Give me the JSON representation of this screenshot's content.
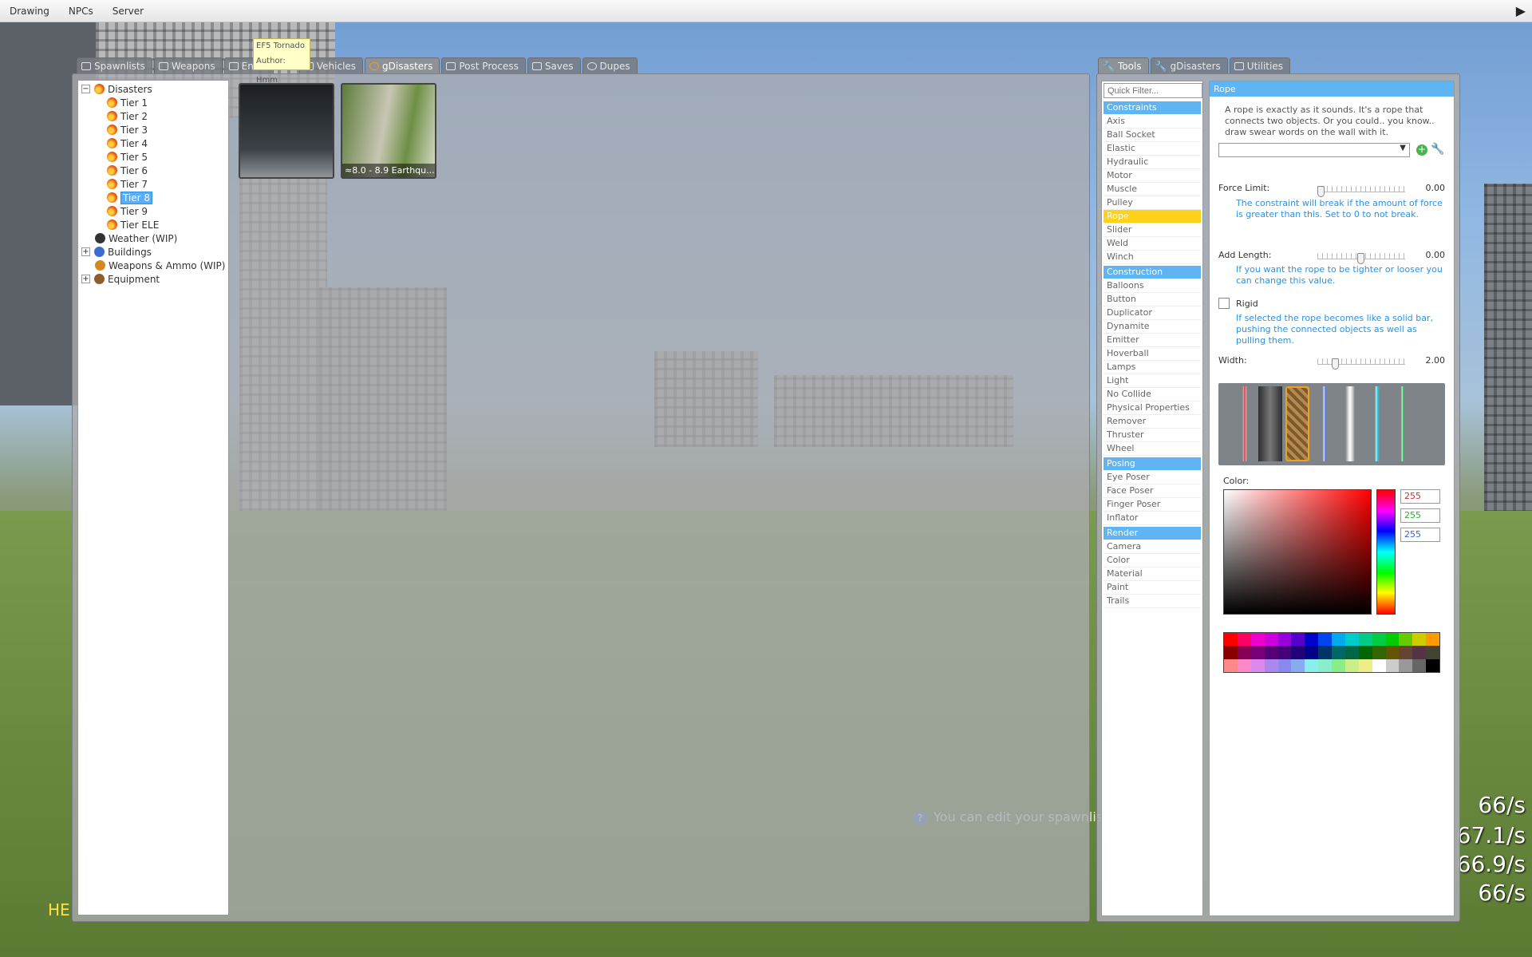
{
  "menubar": {
    "items": [
      "Drawing",
      "NPCs",
      "Server"
    ],
    "expand_icon": "arrow-right-icon"
  },
  "spawn_tabs": [
    {
      "label": "Spawnlists",
      "icon": "spawnlist-icon",
      "active": false
    },
    {
      "label": "Weapons",
      "icon": "weapon-icon",
      "active": false
    },
    {
      "label": "Entiti",
      "icon": "entity-icon",
      "active": false
    },
    {
      "label": "Vehicles",
      "icon": "vehicle-icon",
      "active": false
    },
    {
      "label": "gDisasters",
      "icon": "gdisasters-icon",
      "active": true
    },
    {
      "label": "Post Process",
      "icon": "postprocess-icon",
      "active": false
    },
    {
      "label": "Saves",
      "icon": "saves-icon",
      "active": false
    },
    {
      "label": "Dupes",
      "icon": "dupes-icon",
      "active": false
    }
  ],
  "tooltip": {
    "name": "EF5 Tornado",
    "author": "Author: Hmm"
  },
  "tree": {
    "root": "Disasters",
    "tiers": [
      "Tier 1",
      "Tier 2",
      "Tier 3",
      "Tier 4",
      "Tier 5",
      "Tier 6",
      "Tier 7",
      "Tier 8",
      "Tier 9",
      "Tier ELE"
    ],
    "selected": "Tier 8",
    "others": [
      "Weather (WIP)",
      "Buildings",
      "Weapons & Ammo (WIP)",
      "Equipment"
    ]
  },
  "thumbnails": [
    {
      "caption": ""
    },
    {
      "caption": "≈8.0 - 8.9 Earthqu..."
    }
  ],
  "tool_tabs": [
    {
      "label": "Tools",
      "icon": "wrench-icon",
      "active": true
    },
    {
      "label": "gDisasters",
      "icon": "wrench-icon",
      "active": false
    },
    {
      "label": "Utilities",
      "icon": "utilities-icon",
      "active": false
    }
  ],
  "tool_list": {
    "filter_placeholder": "Quick Filter...",
    "categories": [
      {
        "name": "Constraints",
        "items": [
          "Axis",
          "Ball Socket",
          "Elastic",
          "Hydraulic",
          "Motor",
          "Muscle",
          "Pulley",
          "Rope",
          "Slider",
          "Weld",
          "Winch"
        ]
      },
      {
        "name": "Construction",
        "items": [
          "Balloons",
          "Button",
          "Duplicator",
          "Dynamite",
          "Emitter",
          "Hoverball",
          "Lamps",
          "Light",
          "No Collide",
          "Physical Properties",
          "Remover",
          "Thruster",
          "Wheel"
        ]
      },
      {
        "name": "Posing",
        "items": [
          "Eye Poser",
          "Face Poser",
          "Finger Poser",
          "Inflator"
        ]
      },
      {
        "name": "Render",
        "items": [
          "Camera",
          "Color",
          "Material",
          "Paint",
          "Trails"
        ]
      }
    ],
    "selected": "Rope"
  },
  "options": {
    "title": "Rope",
    "description": "A rope is exactly as it sounds. It's a rope that connects two objects. Or you could.. you know.. draw swear words on the wall with it.",
    "force_limit": {
      "label": "Force Limit:",
      "value": "0.00",
      "level": 0.0
    },
    "force_help": "The constraint will break if the amount of force is greater than this. Set to 0 to not break.",
    "add_length": {
      "label": "Add Length:",
      "value": "0.00",
      "level": 0.5
    },
    "length_help": "If you want the rope to be tighter or looser you can change this value.",
    "rigid": {
      "label": "Rigid",
      "checked": false
    },
    "rigid_help": "If selected the rope becomes like a solid bar, pushing the connected objects as well as pulling them.",
    "width": {
      "label": "Width:",
      "value": "2.00",
      "level": 0.18
    },
    "color_label": "Color:",
    "rgb": [
      "255",
      "255",
      "255"
    ]
  },
  "hud": {
    "he": "HE",
    "notice": "You can edit your spawnlists!",
    "stats": [
      "66/s",
      "67.1/s",
      "66.9/s",
      "66/s"
    ]
  }
}
